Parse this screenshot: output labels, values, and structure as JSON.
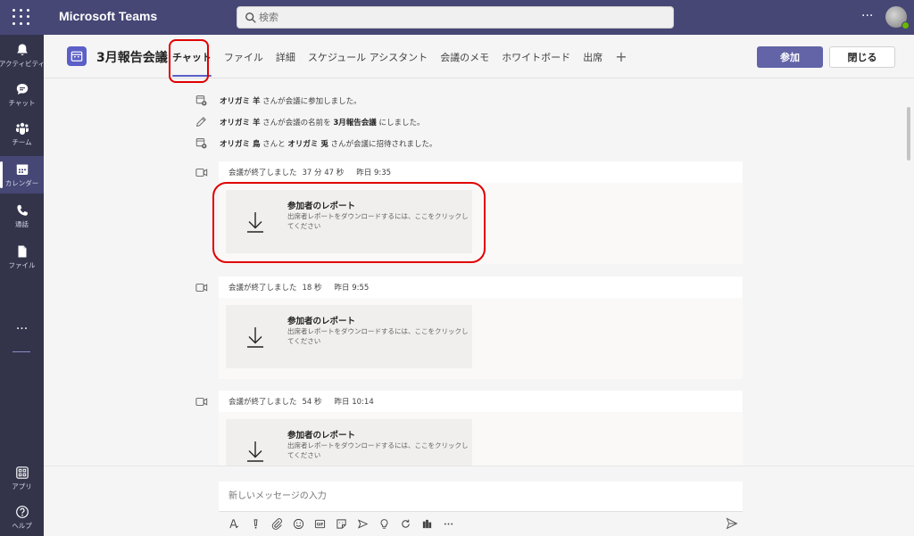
{
  "app": {
    "brand": "Microsoft Teams",
    "more": "···"
  },
  "search": {
    "placeholder": "検索"
  },
  "rail": {
    "items": [
      {
        "label": "アクティビティ",
        "icon": "bell-icon"
      },
      {
        "label": "チャット",
        "icon": "chat-icon"
      },
      {
        "label": "チーム",
        "icon": "teams-icon"
      },
      {
        "label": "カレンダー",
        "icon": "calendar-icon",
        "active": true
      },
      {
        "label": "通話",
        "icon": "phone-icon"
      },
      {
        "label": "ファイル",
        "icon": "file-icon"
      }
    ],
    "more": "···",
    "apps_label": "アプリ",
    "help_label": "ヘルプ"
  },
  "header": {
    "title": "3月報告会議",
    "tabs": [
      "チャット",
      "ファイル",
      "詳細",
      "スケジュール アシスタント",
      "会議のメモ",
      "ホワイトボード",
      "出席"
    ],
    "add_tab": "+",
    "join": "参加",
    "close": "閉じる"
  },
  "system_messages": [
    {
      "name": "オリガミ 羊",
      "text": " さんが会議に参加しました。"
    },
    {
      "name": "オリガミ 羊",
      "text1": " さんが会議の名前を ",
      "name2": "3月報告会議",
      "text2": " にしました。"
    },
    {
      "name": "オリガミ 鳥",
      "text1": " さんと ",
      "name2": "オリガミ 兎",
      "text2": " さんが会議に招待されました。"
    }
  ],
  "meetings": [
    {
      "status": "会議が終了しました",
      "duration": "37 分 47 秒",
      "time": "昨日 9:35"
    },
    {
      "status": "会議が終了しました",
      "duration": "18 秒",
      "time": "昨日 9:55"
    },
    {
      "status": "会議が終了しました",
      "duration": "54 秒",
      "time": "昨日 10:14"
    }
  ],
  "report": {
    "title": "参加者のレポート",
    "description": "出席者レポートをダウンロードするには、ここをクリックしてください"
  },
  "compose": {
    "placeholder": "新しいメッセージの入力"
  }
}
